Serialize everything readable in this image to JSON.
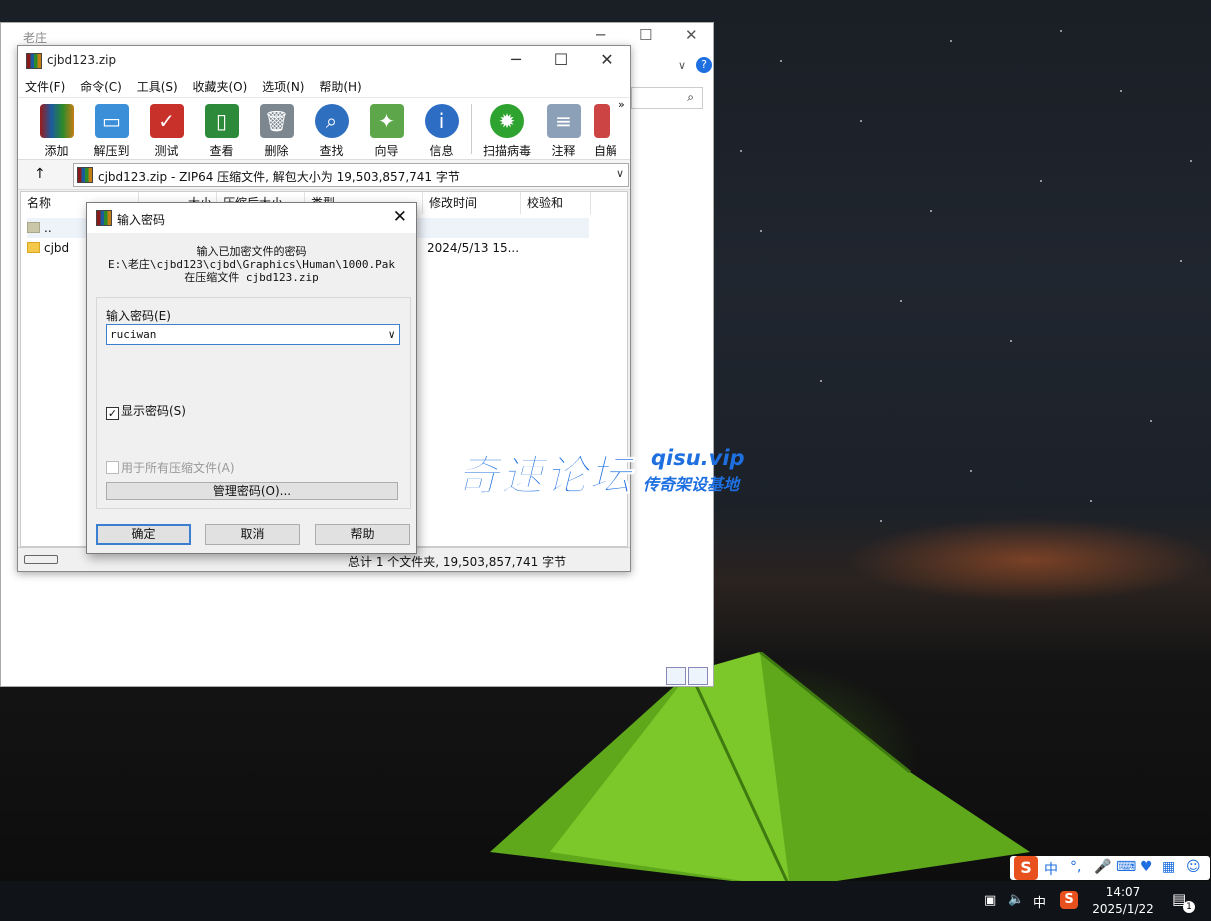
{
  "explorer": {
    "title": "老庄"
  },
  "winrar": {
    "title": "cjbd123.zip",
    "menu": [
      "文件(F)",
      "命令(C)",
      "工具(S)",
      "收藏夹(O)",
      "选项(N)",
      "帮助(H)"
    ],
    "toolbar": [
      "添加",
      "解压到",
      "测试",
      "查看",
      "删除",
      "查找",
      "向导",
      "信息",
      "扫描病毒",
      "注释",
      "自解"
    ],
    "path": "cjbd123.zip - ZIP64 压缩文件, 解包大小为 19,503,857,741 字节",
    "columns": [
      "名称",
      "大小",
      "压缩后大小",
      "类型",
      "修改时间",
      "校验和"
    ],
    "rows": [
      {
        "name": "..",
        "modified": ""
      },
      {
        "name": "cjbd",
        "modified": "2024/5/13 15..."
      }
    ],
    "status": "总计 1 个文件夹, 19,503,857,741 字节"
  },
  "dialog": {
    "title": "输入密码",
    "info_line1": "输入已加密文件的密码",
    "info_line2": "E:\\老庄\\cjbd123\\cjbd\\Graphics\\Human\\1000.Pak",
    "info_line3": "在压缩文件 cjbd123.zip",
    "password_label": "输入密码(E)",
    "password_value": "ruciwan",
    "show_password_label": "显示密码(S)",
    "show_password_checked": true,
    "all_archives_label": "用于所有压缩文件(A)",
    "organize_button": "管理密码(O)...",
    "ok_button": "确定",
    "cancel_button": "取消",
    "help_button": "帮助"
  },
  "watermark": {
    "text": "奇速论坛",
    "url": "qisu.vip",
    "slogan": "传奇架设基地"
  },
  "ime": {
    "mode": "中"
  },
  "taskbar": {
    "ime": "中",
    "time": "14:07",
    "date": "2025/1/22",
    "notifications": "1"
  }
}
